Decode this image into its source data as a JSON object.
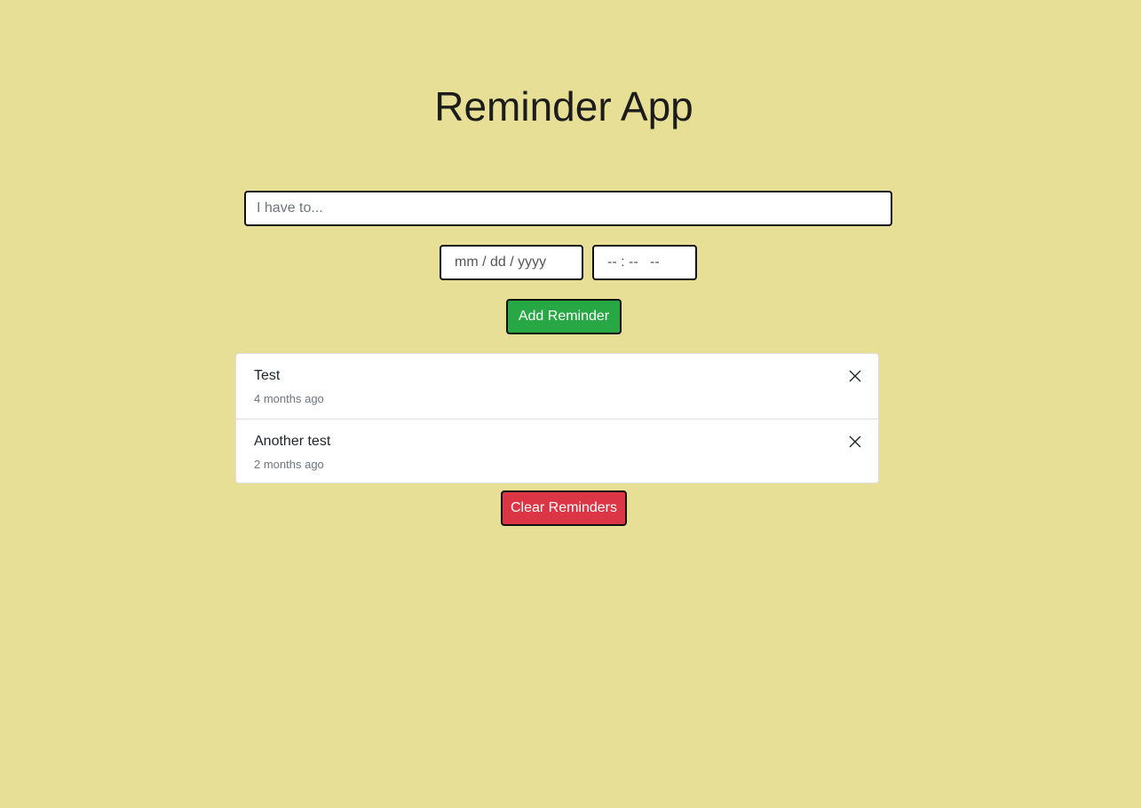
{
  "app": {
    "title": "Reminder App"
  },
  "form": {
    "task_placeholder": "I have to...",
    "date_placeholder": "mm / dd / yyyy",
    "time_placeholder": "-- : --   --",
    "add_label": "Add Reminder"
  },
  "reminders": [
    {
      "text": "Test",
      "time": "4 months ago",
      "delete_icon": "close-icon"
    },
    {
      "text": "Another test",
      "time": "2 months ago",
      "delete_icon": "close-icon"
    }
  ],
  "actions": {
    "clear_label": "Clear Reminders"
  },
  "colors": {
    "background": "#e8df96",
    "add_button": "#28a745",
    "clear_button": "#dc3545"
  }
}
